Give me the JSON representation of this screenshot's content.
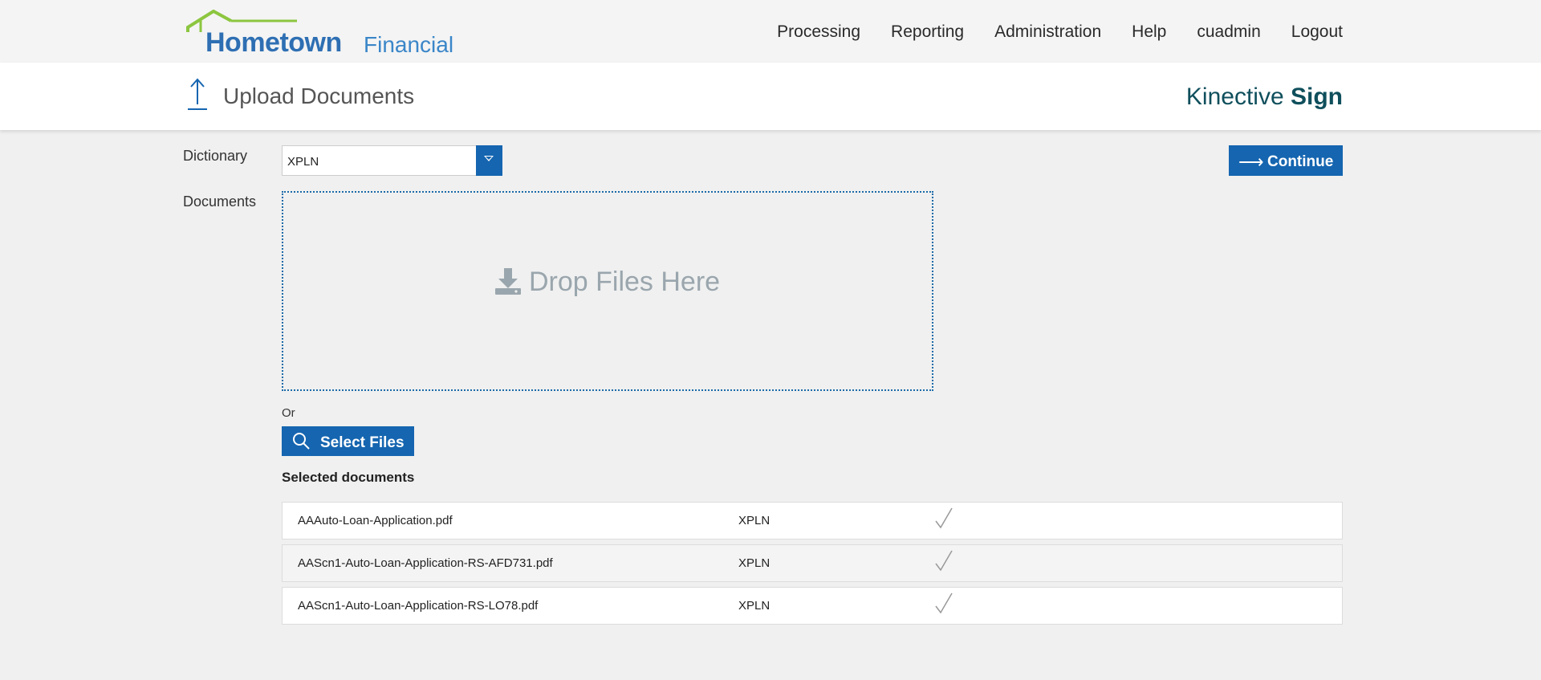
{
  "brand": {
    "name_part1": "Hometown",
    "name_part2": "Financial"
  },
  "nav": {
    "items": [
      "Processing",
      "Reporting",
      "Administration",
      "Help",
      "cuadmin",
      "Logout"
    ]
  },
  "header": {
    "page_title": "Upload Documents",
    "product_name_light": "Kinective",
    "product_name_bold": "Sign",
    "icon": "upload-arrow-icon"
  },
  "form": {
    "dictionary_label": "Dictionary",
    "dictionary_value": "XPLN",
    "documents_label": "Documents",
    "continue_label": "Continue",
    "dropzone_text": "Drop Files Here",
    "or_text": "Or",
    "select_files_label": "Select Files",
    "selected_heading": "Selected documents"
  },
  "documents": [
    {
      "filename": "AAAuto-Loan-Application.pdf",
      "dictionary": "XPLN",
      "status": "check-icon"
    },
    {
      "filename": "AAScn1-Auto-Loan-Application-RS-AFD731.pdf",
      "dictionary": "XPLN",
      "status": "check-icon"
    },
    {
      "filename": "AAScn1-Auto-Loan-Application-RS-LO78.pdf",
      "dictionary": "XPLN",
      "status": "check-icon"
    }
  ],
  "colors": {
    "primary_blue": "#1565b0",
    "brand_green": "#8cc63f",
    "brand_blue": "#2e6fb3",
    "product_teal": "#0f4f5c",
    "dropzone_text": "#9aa6ad"
  }
}
